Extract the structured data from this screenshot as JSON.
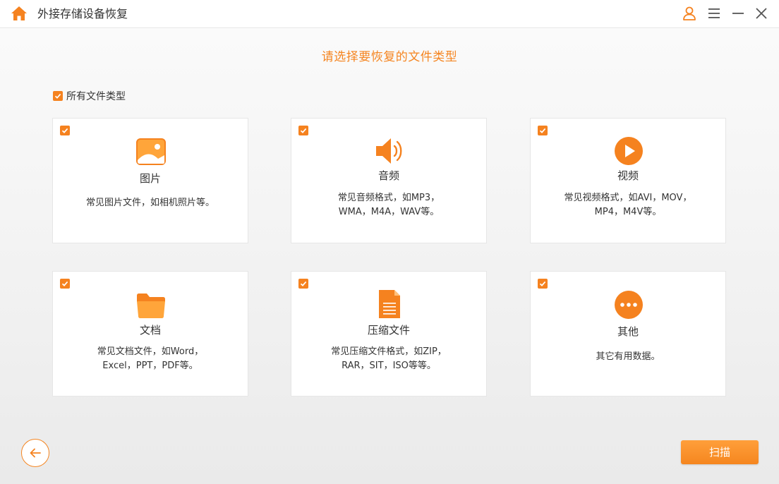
{
  "app": {
    "title": "外接存储设备恢复"
  },
  "main": {
    "heading": "请选择要恢复的文件类型",
    "all_types_label": "所有文件类型",
    "cards": [
      {
        "title": "图片",
        "desc_lines": [
          "常见图片文件，如相机照片等。"
        ],
        "icon": "image-icon"
      },
      {
        "title": "音频",
        "desc_lines": [
          "常见音频格式，如MP3，",
          "WMA，M4A，WAV等。"
        ],
        "icon": "audio-icon"
      },
      {
        "title": "视频",
        "desc_lines": [
          "常见视频格式，如AVI，MOV，",
          "MP4，M4V等。"
        ],
        "icon": "video-icon"
      },
      {
        "title": "文档",
        "desc_lines": [
          "常见文档文件，如Word，",
          "Excel，PPT，PDF等。"
        ],
        "icon": "folder-icon"
      },
      {
        "title": "压缩文件",
        "desc_lines": [
          "常见压缩文件格式，如ZIP，",
          "RAR，SIT，ISO等等。"
        ],
        "icon": "archive-icon"
      },
      {
        "title": "其他",
        "desc_lines": [
          "其它有用数据。"
        ],
        "icon": "more-icon"
      }
    ]
  },
  "footer": {
    "scan_label": "扫描"
  },
  "colors": {
    "accent": "#f5821f",
    "heading": "#f58520"
  }
}
